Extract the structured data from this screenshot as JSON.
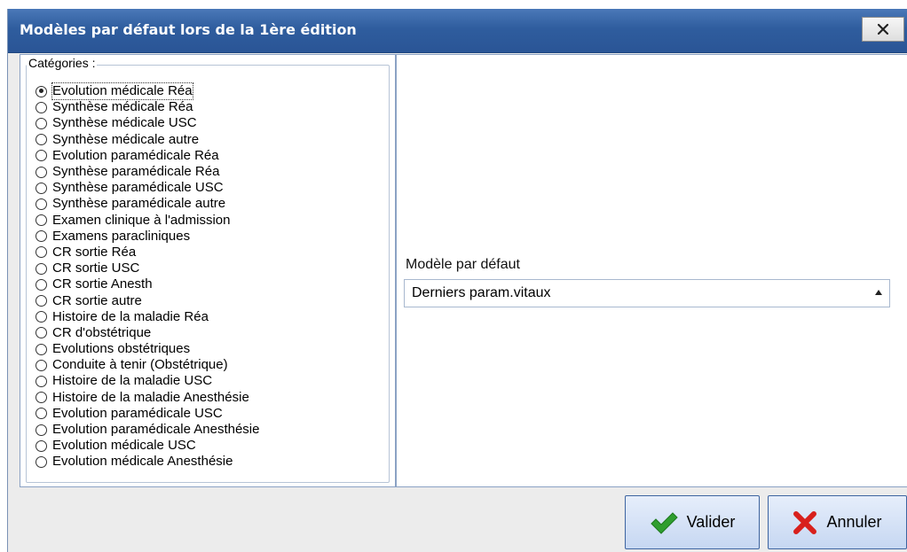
{
  "window": {
    "title": "Modèles par défaut lors de la 1ère édition"
  },
  "categories": {
    "legend": "Catégories :",
    "selected_index": 0,
    "items": [
      "Evolution médicale Réa",
      "Synthèse médicale Réa",
      "Synthèse médicale USC",
      "Synthèse médicale autre",
      "Evolution paramédicale Réa",
      "Synthèse paramédicale Réa",
      "Synthèse paramédicale USC",
      "Synthèse paramédicale autre",
      "Examen clinique à l'admission",
      "Examens paracliniques",
      "CR sortie Réa",
      "CR sortie USC",
      "CR sortie Anesth",
      "CR sortie autre",
      "Histoire de la maladie Réa",
      "CR d'obstétrique",
      "Evolutions obstétriques",
      "Conduite à tenir (Obstétrique)",
      "Histoire de la maladie USC",
      "Histoire de la maladie Anesthésie",
      "Evolution paramédicale USC",
      "Evolution paramédicale Anesthésie",
      "Evolution médicale USC",
      "Evolution médicale Anesthésie"
    ]
  },
  "default_model": {
    "label": "Modèle par défaut",
    "value": "Derniers param.vitaux"
  },
  "buttons": {
    "ok_label": "Valider",
    "cancel_label": "Annuler"
  },
  "icons": {
    "close": "close-icon",
    "ok": "checkmark-icon",
    "cancel": "red-x-icon",
    "dropdown": "triangle-up-icon"
  },
  "colors": {
    "titlebar": "#2f5d9e",
    "check_green": "#2f9e2f",
    "cancel_red": "#d8201c"
  }
}
